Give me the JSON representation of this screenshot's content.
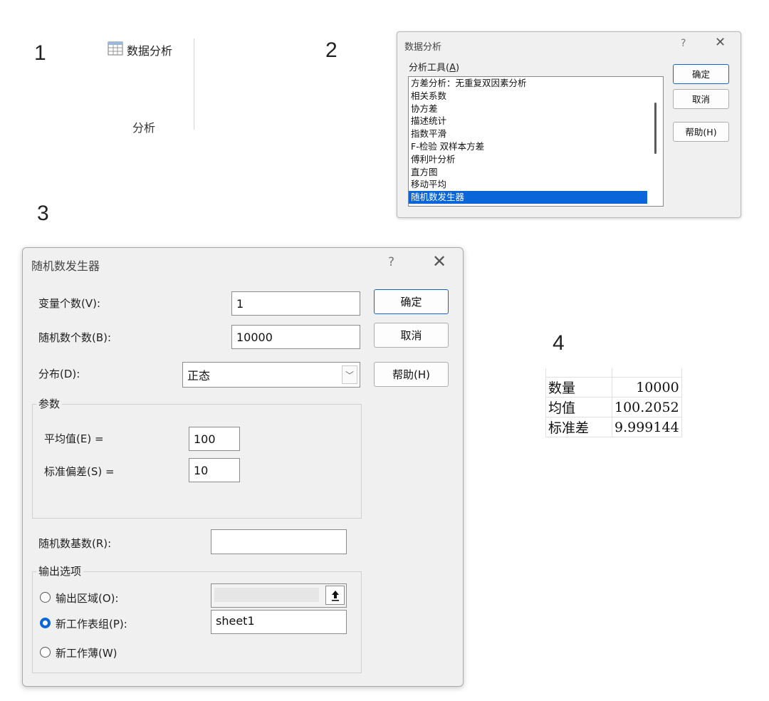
{
  "steps": [
    "1",
    "2",
    "3",
    "4"
  ],
  "ribbon": {
    "button_label": "数据分析",
    "group_label": "分析"
  },
  "analysis_dialog": {
    "title": "数据分析",
    "help_mark": "?",
    "close_mark": "✕",
    "tools_label": "分析工具(A)",
    "tools_label_key": "A",
    "tools": [
      "方差分析：无重复双因素分析",
      "相关系数",
      "协方差",
      "描述统计",
      "指数平滑",
      "F-检验 双样本方差",
      "傅利叶分析",
      "直方图",
      "移动平均",
      "随机数发生器"
    ],
    "selected_tool": "随机数发生器",
    "ok_label": "确定",
    "cancel_label": "取消",
    "help_label": "帮助(H)"
  },
  "rng_dialog": {
    "title": "随机数发生器",
    "help_mark": "?",
    "close_mark": "✕",
    "variables_label": "变量个数(V):",
    "variables_value": "1",
    "count_label": "随机数个数(B):",
    "count_value": "10000",
    "distribution_label": "分布(D):",
    "distribution_value": "正态",
    "params_group": "参数",
    "mean_label": "平均值(E) =",
    "mean_value": "100",
    "stddev_label": "标准偏差(S) =",
    "stddev_value": "10",
    "seed_label": "随机数基数(R):",
    "seed_value": "",
    "output_group": "输出选项",
    "output_range_label": "输出区域(O):",
    "new_sheet_label": "新工作表组(P):",
    "new_sheet_value": "sheet1",
    "new_workbook_label": "新工作薄(W)",
    "selected_output": "new_sheet",
    "ok_label": "确定",
    "cancel_label": "取消",
    "help_label": "帮助(H)"
  },
  "results": [
    {
      "label": "数量",
      "value": "10000"
    },
    {
      "label": "均值",
      "value": "100.2052"
    },
    {
      "label": "标准差",
      "value": "9.999144"
    }
  ],
  "colors": {
    "accent": "#0a66d8",
    "dialog_bg": "#f0f0f0"
  }
}
